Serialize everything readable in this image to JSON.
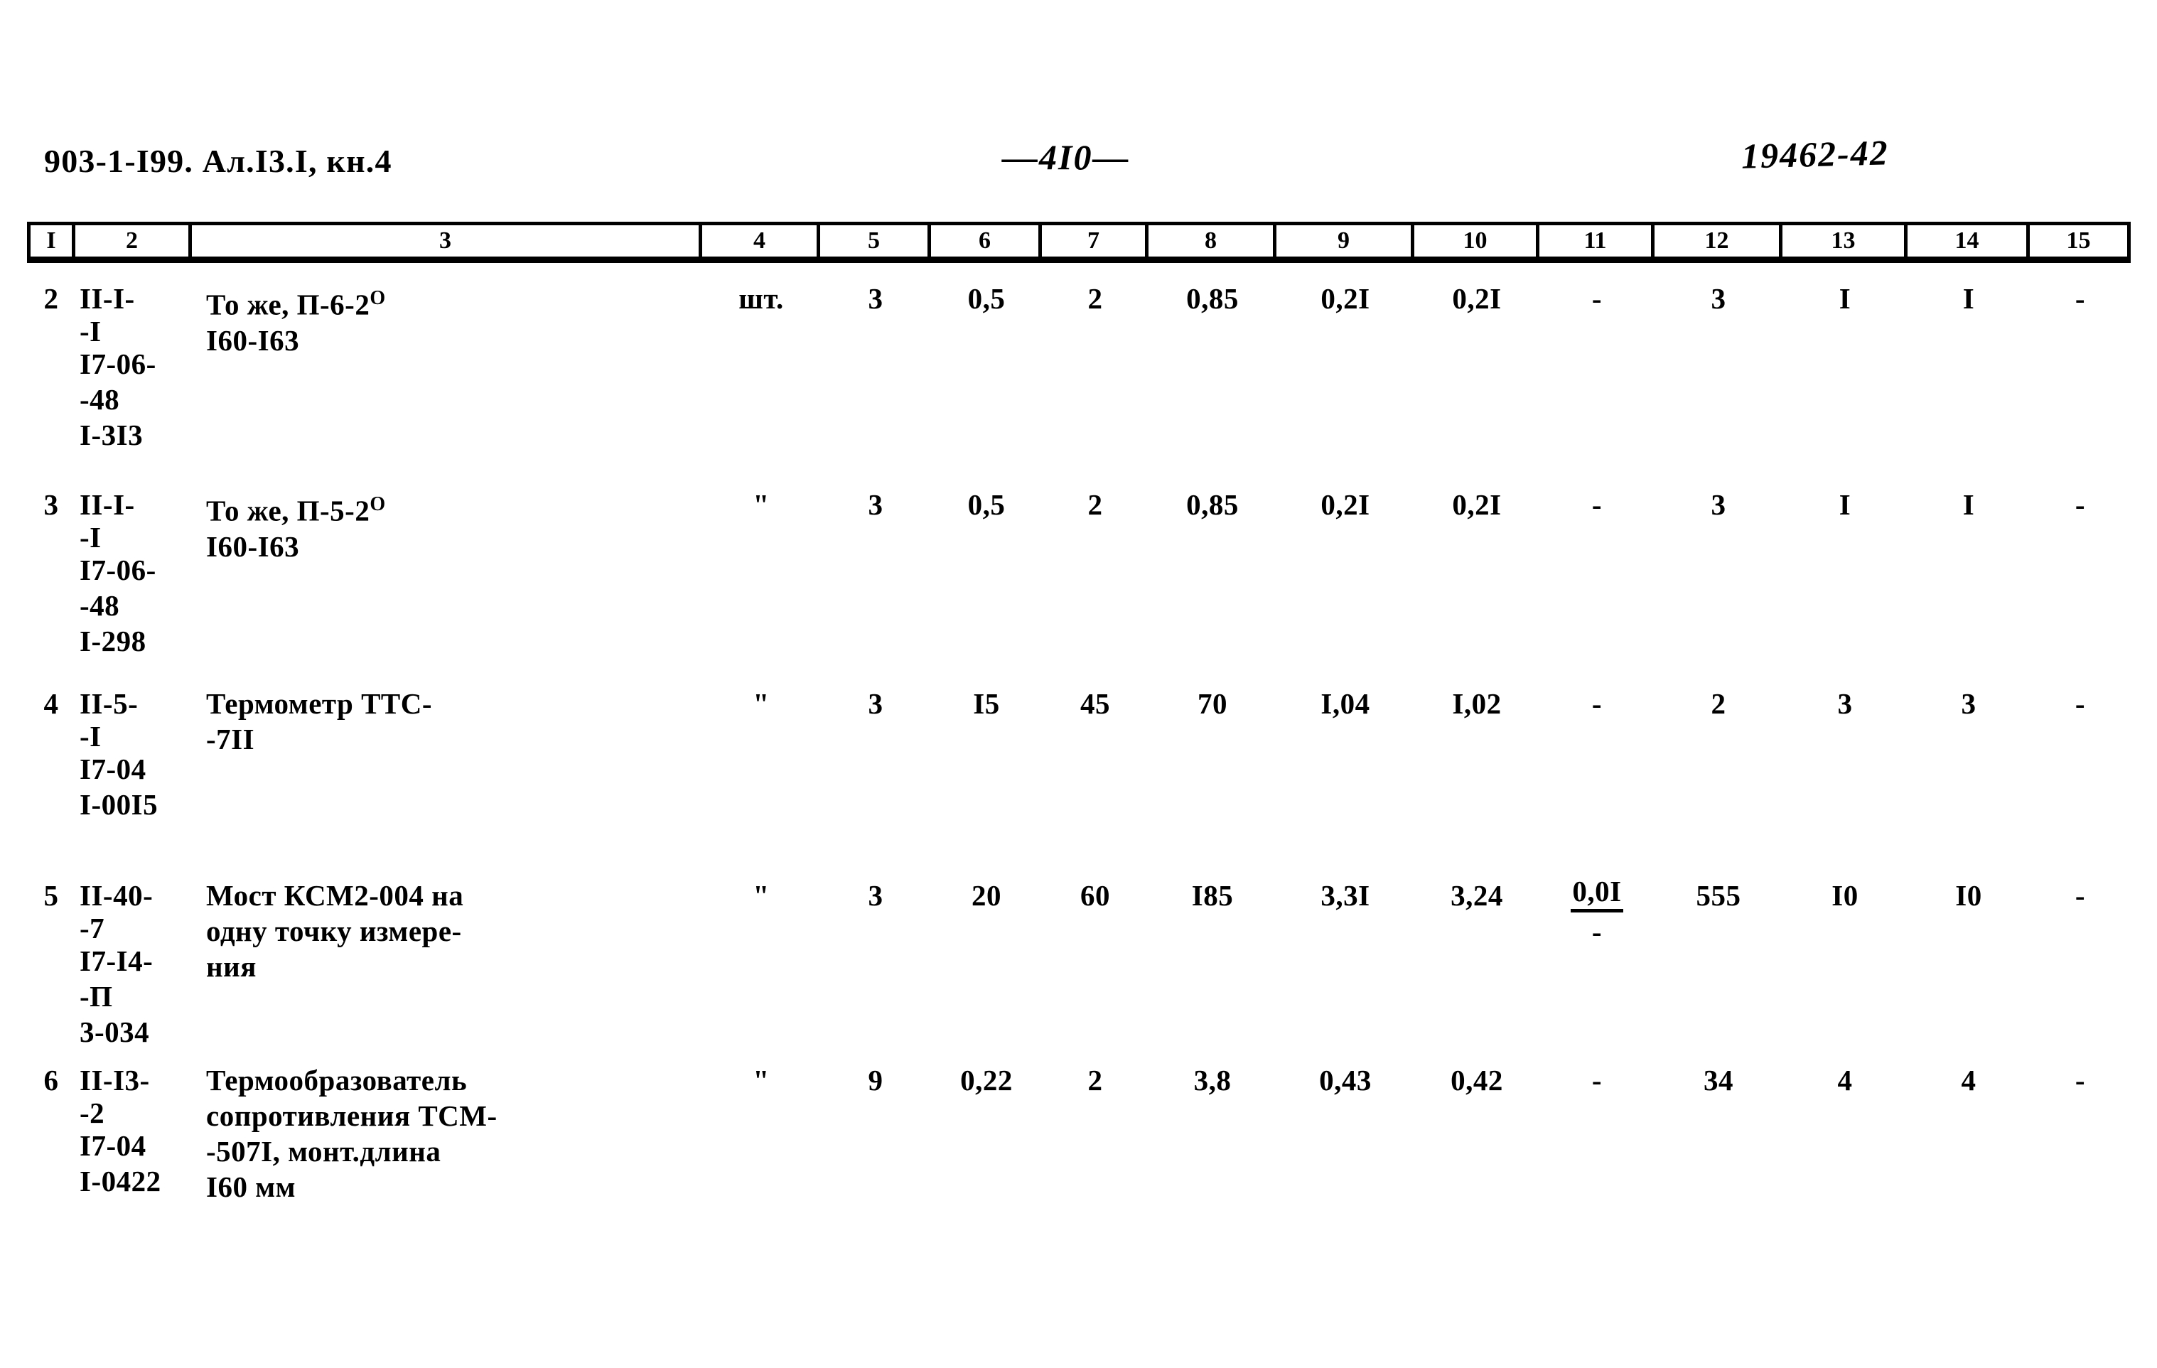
{
  "header": {
    "left": "903-1-I99. Ал.I3.I, кн.4",
    "page_number": "—4I0—",
    "stamp": "19462-42"
  },
  "table": {
    "column_headers": [
      "I",
      "2",
      "3",
      "4",
      "5",
      "6",
      "7",
      "8",
      "9",
      "10",
      "11",
      "12",
      "13",
      "14",
      "15"
    ],
    "rows": [
      {
        "num": "2",
        "code": [
          "II-I-",
          "-I",
          "I7-06-",
          "-48",
          "I-3I3"
        ],
        "desc": [
          "То же, П-6-2°",
          "I60-I63"
        ],
        "unit": "шт.",
        "c5": "3",
        "c6": "0,5",
        "c7": "2",
        "c8": "0,85",
        "c9": "0,2I",
        "c10": "0,2I",
        "c11": "-",
        "c12": "3",
        "c13": "I",
        "c14": "I",
        "c15": "-"
      },
      {
        "num": "3",
        "code": [
          "II-I-",
          "-I",
          "I7-06-",
          "-48",
          "I-298"
        ],
        "desc": [
          "То же, П-5-2°",
          "I60-I63"
        ],
        "unit": "\"",
        "c5": "3",
        "c6": "0,5",
        "c7": "2",
        "c8": "0,85",
        "c9": "0,2I",
        "c10": "0,2I",
        "c11": "-",
        "c12": "3",
        "c13": "I",
        "c14": "I",
        "c15": "-"
      },
      {
        "num": "4",
        "code": [
          "II-5-",
          "-I",
          "I7-04",
          "I-00I5"
        ],
        "desc": [
          "Термометр ТТС-",
          "-7II"
        ],
        "unit": "\"",
        "c5": "3",
        "c6": "I5",
        "c7": "45",
        "c8": "70",
        "c9": "I,04",
        "c10": "I,02",
        "c11": "-",
        "c12": "2",
        "c13": "3",
        "c14": "3",
        "c15": "-"
      },
      {
        "num": "5",
        "code": [
          "II-40-",
          "-7",
          "I7-I4-",
          "-П",
          "3-034"
        ],
        "desc": [
          "Мост КСМ2-004 на",
          "одну точку измере-",
          "ния"
        ],
        "unit": "\"",
        "c5": "3",
        "c6": "20",
        "c7": "60",
        "c8": "I85",
        "c9": "3,3I",
        "c10": "3,24",
        "c11_numerator": "0,0I",
        "c11_denominator": "-",
        "c12": "555",
        "c13": "I0",
        "c14": "I0",
        "c15": "-"
      },
      {
        "num": "6",
        "code": [
          "II-I3-",
          "-2",
          "I7-04",
          "I-0422"
        ],
        "desc": [
          "Термообразователь",
          "сопротивления ТСМ-",
          "-507I, монт.длина",
          "I60 мм"
        ],
        "unit": "\"",
        "c5": "9",
        "c6": "0,22",
        "c7": "2",
        "c8": "3,8",
        "c9": "0,43",
        "c10": "0,42",
        "c11": "-",
        "c12": "34",
        "c13": "4",
        "c14": "4",
        "c15": "-"
      }
    ]
  }
}
